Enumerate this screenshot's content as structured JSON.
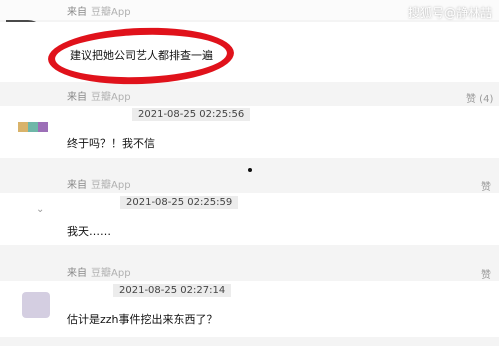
{
  "header": {
    "source": "来自",
    "app": "豆瓣App",
    "watermark": "搜狐号@静林喆"
  },
  "comments": [
    {
      "text": "建议把她公司艺人都排查一遍",
      "highlighted": true
    },
    {
      "source": "来自",
      "app": "豆瓣App",
      "like": "赞 (4)",
      "timestamp": "2021-08-25 02:25:56",
      "text": "终于吗？！我不信"
    },
    {
      "source": "来自",
      "app": "豆瓣App",
      "like": "赞",
      "timestamp": "2021-08-25 02:25:59",
      "text": "我天……"
    },
    {
      "source": "来自",
      "app": "豆瓣App",
      "like": "赞",
      "timestamp": "2021-08-25 02:27:14",
      "text": "估计是zzh事件挖出来东西了？"
    }
  ],
  "colors": {
    "highlight_circle": "#e0121b",
    "background": "#f4f4f4"
  }
}
